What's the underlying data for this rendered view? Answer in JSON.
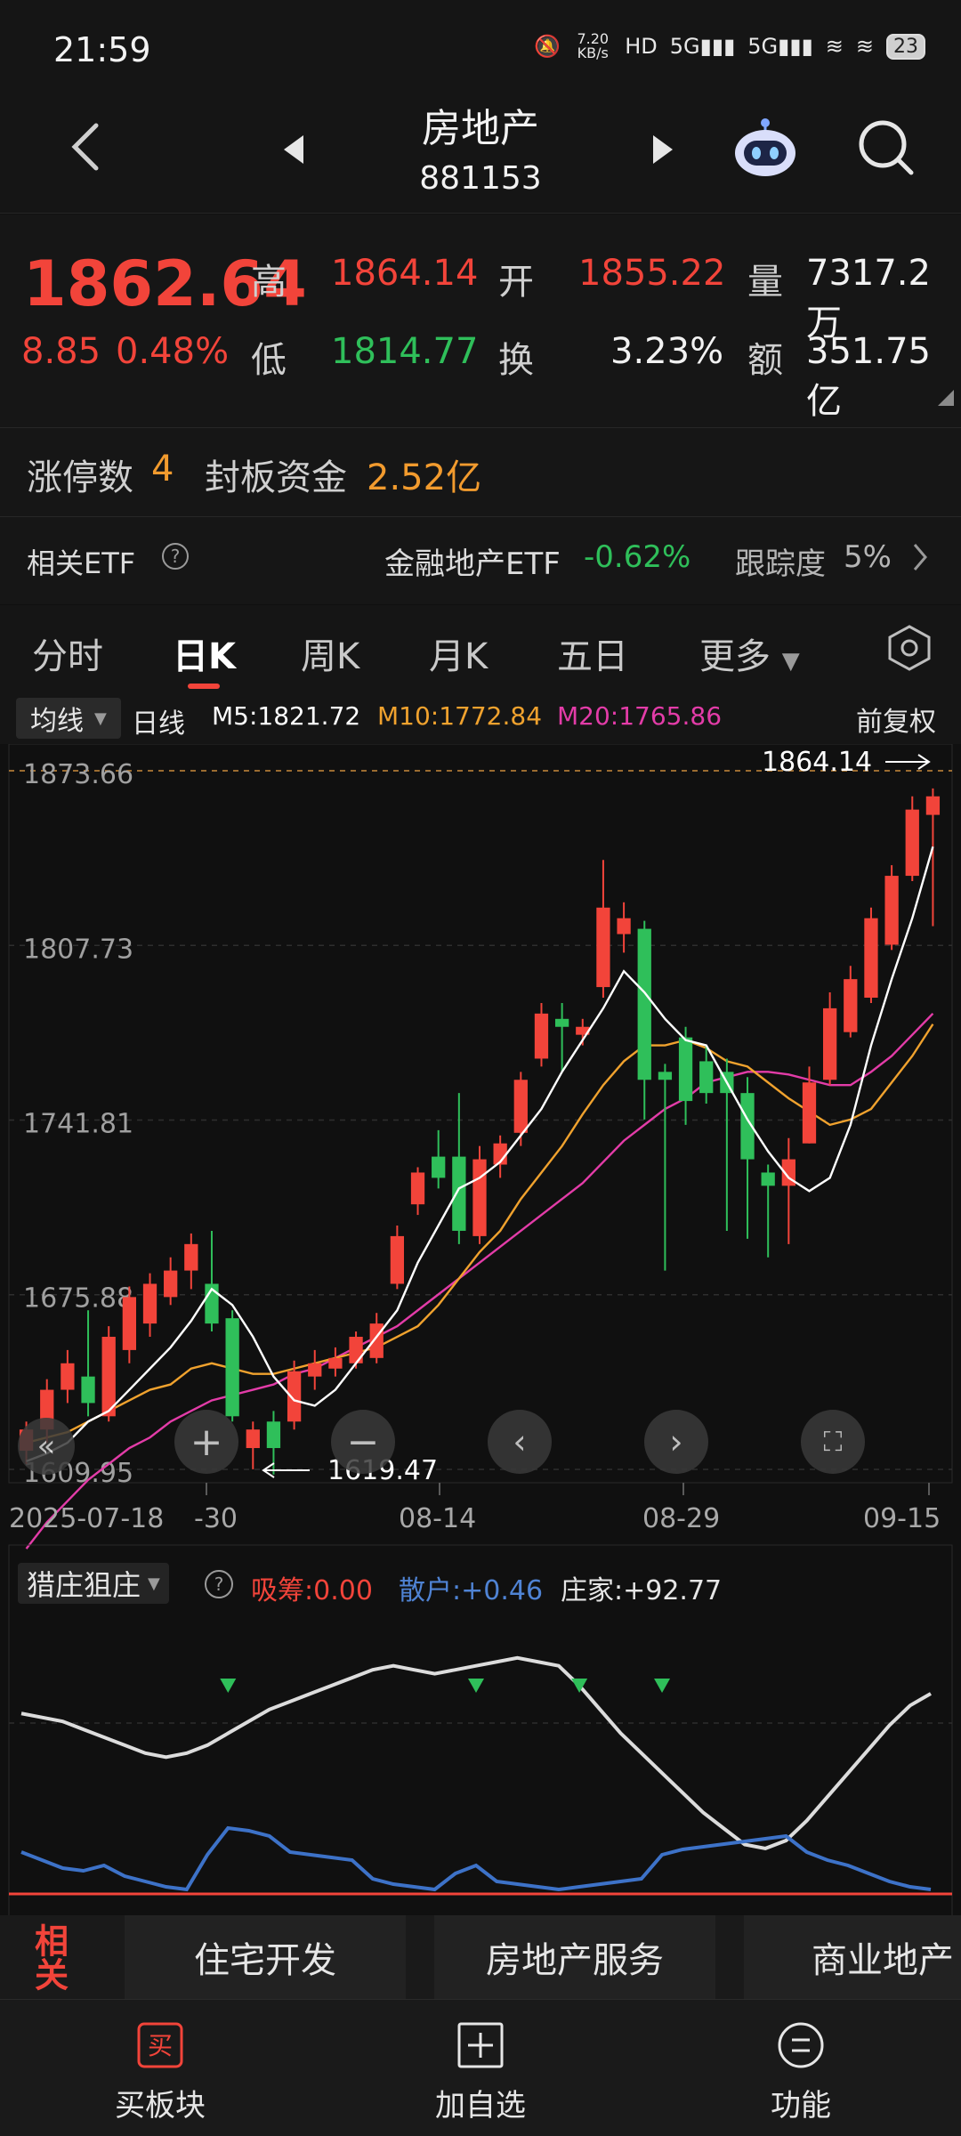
{
  "status": {
    "time": "21:59",
    "speed": "7.20 KB/s",
    "battery": "23"
  },
  "header": {
    "title": "房地产",
    "code": "881153"
  },
  "quote": {
    "price": "1862.64",
    "change": "8.85",
    "change_pct": "0.48%",
    "high_label": "高",
    "high": "1864.14",
    "open_label": "开",
    "open": "1855.22",
    "volume_label": "量",
    "volume": "7317.2万",
    "low_label": "低",
    "low": "1814.77",
    "turnover_label": "换",
    "turnover": "3.23%",
    "amount_label": "额",
    "amount": "351.75亿"
  },
  "limit": {
    "count_label": "涨停数",
    "count": "4",
    "fund_label": "封板资金",
    "fund": "2.52亿"
  },
  "etf": {
    "label": "相关ETF",
    "name": "金融地产ETF",
    "change": "-0.62%",
    "track_label": "跟踪度",
    "track": "5%"
  },
  "tabs": [
    "分时",
    "日K",
    "周K",
    "月K",
    "五日",
    "更多"
  ],
  "ma": {
    "selector": "均线",
    "line_type": "日线",
    "m5": "M5:1821.72",
    "m10": "M10:1772.84",
    "m20": "M20:1765.86",
    "adjust": "前复权"
  },
  "colors": {
    "up": "#f2443a",
    "down": "#2fbf5a",
    "m5": "#ffffff",
    "m10": "#f0a22e",
    "m20": "#e33ca8"
  },
  "indicator": {
    "name": "猎庄狙庄",
    "x1": "吸筹:0.00",
    "x2": "散户:+0.46",
    "x3": "庄家:+92.77"
  },
  "categories": [
    "住宅开发",
    "房地产服务",
    "商业地产"
  ],
  "side_label": "相关",
  "footer": [
    "买板块",
    "加自选",
    "功能"
  ],
  "chart_data": {
    "type": "candlestick",
    "x_ticks": [
      "2025-07-18",
      "-30",
      "08-14",
      "08-29",
      "09-15"
    ],
    "y_ticks": [
      "1873.66",
      "1807.73",
      "1741.81",
      "1675.88",
      "1609.95"
    ],
    "ylim": [
      1609.95,
      1873.66
    ],
    "max_label": "1864.14",
    "min_label": "1619.47",
    "candles": [
      [
        1617,
        1625,
        1612,
        1628
      ],
      [
        1625,
        1640,
        1620,
        1644
      ],
      [
        1640,
        1650,
        1635,
        1655
      ],
      [
        1645,
        1635,
        1630,
        1670
      ],
      [
        1630,
        1660,
        1628,
        1664
      ],
      [
        1655,
        1675,
        1650,
        1679
      ],
      [
        1665,
        1680,
        1660,
        1684
      ],
      [
        1675,
        1685,
        1672,
        1690
      ],
      [
        1685,
        1695,
        1678,
        1699
      ],
      [
        1680,
        1665,
        1662,
        1700
      ],
      [
        1667,
        1630,
        1628,
        1670
      ],
      [
        1618,
        1625,
        1610,
        1628
      ],
      [
        1628,
        1618,
        1608,
        1632
      ],
      [
        1628,
        1647,
        1625,
        1651
      ],
      [
        1645,
        1650,
        1640,
        1655
      ],
      [
        1648,
        1652,
        1645,
        1656
      ],
      [
        1650,
        1660,
        1648,
        1662
      ],
      [
        1652,
        1665,
        1650,
        1669
      ],
      [
        1680,
        1698,
        1678,
        1702
      ],
      [
        1710,
        1722,
        1706,
        1724
      ],
      [
        1728,
        1720,
        1716,
        1738
      ],
      [
        1728,
        1700,
        1695,
        1752
      ],
      [
        1698,
        1727,
        1695,
        1732
      ],
      [
        1725,
        1733,
        1720,
        1736
      ],
      [
        1737,
        1757,
        1732,
        1760
      ],
      [
        1765,
        1782,
        1762,
        1786
      ],
      [
        1780,
        1777,
        1760,
        1786
      ],
      [
        1774,
        1777,
        1770,
        1780
      ],
      [
        1792,
        1822,
        1788,
        1840
      ],
      [
        1812,
        1818,
        1805,
        1824
      ],
      [
        1814,
        1757,
        1742,
        1817
      ],
      [
        1760,
        1757,
        1685,
        1763
      ],
      [
        1773,
        1749,
        1740,
        1777
      ],
      [
        1764,
        1752,
        1748,
        1770
      ],
      [
        1760,
        1752,
        1700,
        1765
      ],
      [
        1752,
        1727,
        1697,
        1758
      ],
      [
        1722,
        1717,
        1690,
        1725
      ],
      [
        1717,
        1727,
        1695,
        1735
      ],
      [
        1733,
        1756,
        1733,
        1762
      ],
      [
        1757,
        1784,
        1755,
        1790
      ],
      [
        1775,
        1795,
        1773,
        1800
      ],
      [
        1788,
        1818,
        1786,
        1822
      ],
      [
        1808,
        1834,
        1806,
        1838
      ],
      [
        1834,
        1859,
        1832,
        1864
      ],
      [
        1857,
        1864,
        1815,
        1867
      ]
    ],
    "m5": [
      1613,
      1616,
      1620,
      1628,
      1632,
      1640,
      1648,
      1656,
      1666,
      1678,
      1672,
      1660,
      1645,
      1636,
      1634,
      1640,
      1650,
      1660,
      1670,
      1688,
      1702,
      1716,
      1720,
      1726,
      1736,
      1746,
      1760,
      1772,
      1784,
      1798,
      1790,
      1780,
      1772,
      1770,
      1756,
      1742,
      1730,
      1720,
      1715,
      1720,
      1740,
      1770,
      1795,
      1818,
      1845
    ],
    "m10": [
      1620,
      1622,
      1624,
      1628,
      1632,
      1636,
      1640,
      1642,
      1648,
      1650,
      1648,
      1646,
      1646,
      1648,
      1650,
      1652,
      1654,
      1656,
      1660,
      1664,
      1672,
      1682,
      1692,
      1700,
      1712,
      1722,
      1732,
      1744,
      1755,
      1764,
      1770,
      1770,
      1772,
      1769,
      1764,
      1762,
      1756,
      1750,
      1745,
      1740,
      1742,
      1746,
      1756,
      1766,
      1778
    ],
    "m20": [
      1580,
      1590,
      1598,
      1606,
      1612,
      1618,
      1622,
      1628,
      1632,
      1636,
      1638,
      1640,
      1642,
      1646,
      1648,
      1652,
      1656,
      1660,
      1664,
      1670,
      1676,
      1682,
      1688,
      1694,
      1700,
      1706,
      1712,
      1718,
      1726,
      1734,
      1740,
      1746,
      1750,
      1756,
      1758,
      1760,
      1760,
      1759,
      1757,
      1755,
      1755,
      1760,
      1766,
      1774,
      1782
    ],
    "ind_white": [
      90,
      88,
      86,
      82,
      78,
      74,
      70,
      68,
      70,
      74,
      80,
      86,
      92,
      96,
      100,
      104,
      108,
      112,
      114,
      112,
      110,
      112,
      114,
      116,
      118,
      116,
      114,
      104,
      92,
      80,
      70,
      60,
      50,
      40,
      32,
      24,
      22,
      26,
      36,
      48,
      60,
      72,
      84,
      94,
      100
    ],
    "ind_blue": [
      30,
      24,
      18,
      16,
      20,
      12,
      8,
      4,
      2,
      28,
      48,
      46,
      42,
      30,
      28,
      26,
      24,
      10,
      6,
      4,
      2,
      14,
      20,
      8,
      6,
      4,
      2,
      4,
      6,
      8,
      10,
      28,
      32,
      34,
      36,
      38,
      40,
      42,
      30,
      24,
      20,
      14,
      8,
      4,
      2
    ],
    "ind_markers": [
      10,
      22,
      27,
      31
    ]
  }
}
